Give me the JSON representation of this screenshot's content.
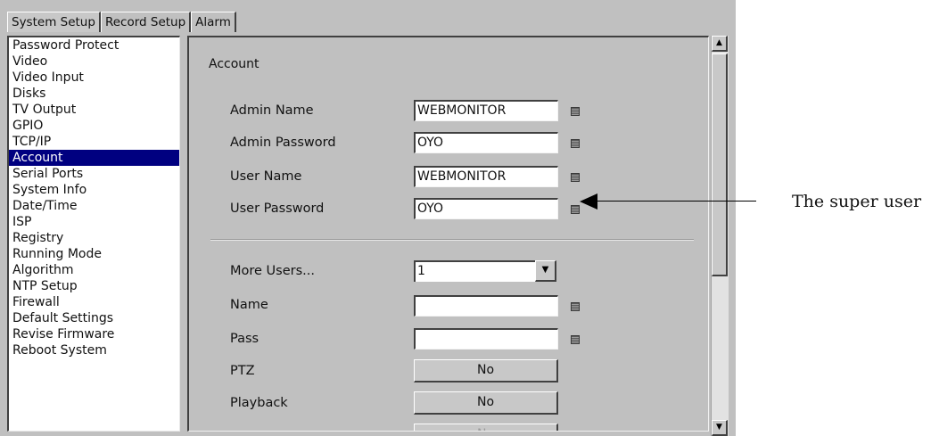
{
  "tabs": [
    "System Setup",
    "Record Setup",
    "Alarm"
  ],
  "menu": {
    "items": [
      "Password Protect",
      "Video",
      "Video Input",
      "Disks",
      "TV Output",
      "GPIO",
      "TCP/IP",
      "Account",
      "Serial Ports",
      "System Info",
      "Date/Time",
      "ISP",
      "Registry",
      "Running Mode",
      "Algorithm",
      "NTP Setup",
      "Firewall",
      "Default Settings",
      "Revise Firmware",
      "Reboot System"
    ],
    "selected": "Account"
  },
  "account": {
    "title": "Account",
    "admin_name_label": "Admin Name",
    "admin_name_value": "WEBMONITOR",
    "admin_password_label": "Admin Password",
    "admin_password_value": "OYO",
    "user_name_label": "User Name",
    "user_name_value": "WEBMONITOR",
    "user_password_label": "User Password",
    "user_password_value": "OYO",
    "more_users_label": "More Users...",
    "more_users_value": "1",
    "name_label": "Name",
    "name_value": "",
    "pass_label": "Pass",
    "pass_value": "",
    "ptz_label": "PTZ",
    "ptz_value": "No",
    "playback_label": "Playback",
    "playback_value": "No",
    "audio_value": "No"
  },
  "annotation": {
    "text": "The super user"
  },
  "colors": {
    "selection": "#000080",
    "window": "#c0c0c0"
  },
  "icons": [
    "keyboard-icon",
    "dropdown-arrow-icon",
    "scroll-up-icon",
    "scroll-down-icon",
    "arrow-icon"
  ]
}
